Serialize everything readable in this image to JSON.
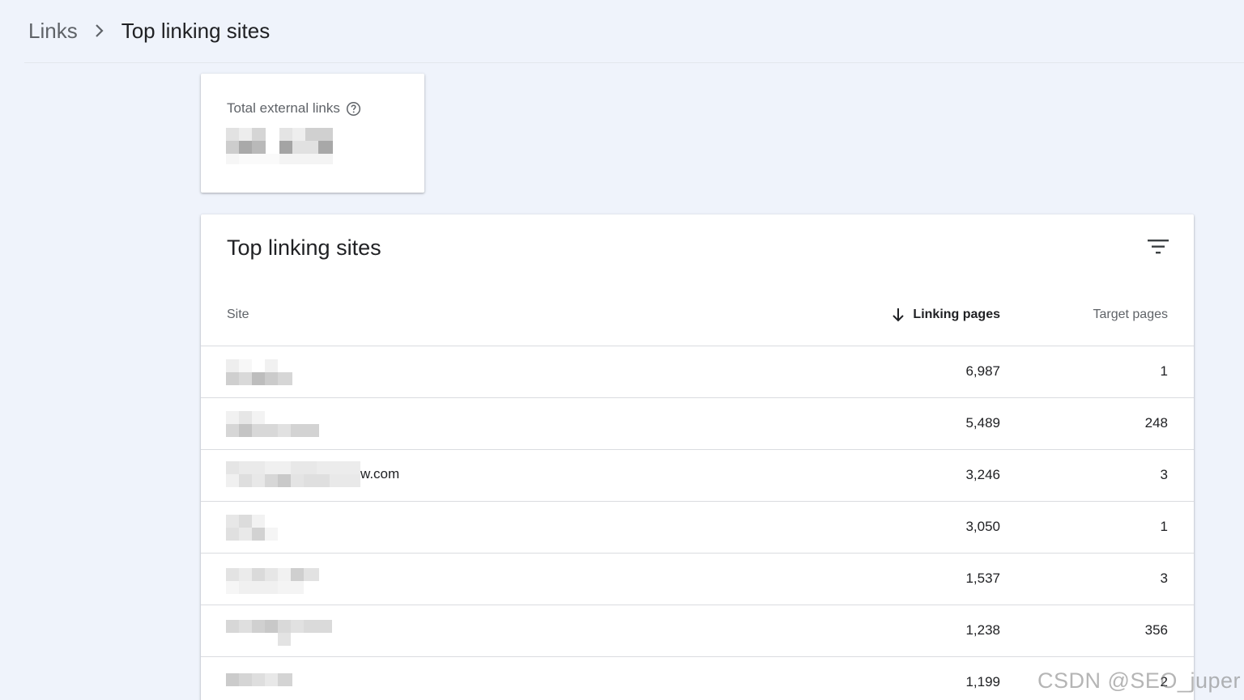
{
  "breadcrumb": {
    "parent": "Links",
    "current": "Top linking sites"
  },
  "summary": {
    "label": "Total external links"
  },
  "table": {
    "title": "Top linking sites",
    "columns": {
      "site": "Site",
      "linking_pages": "Linking pages",
      "target_pages": "Target pages"
    },
    "rows": [
      {
        "site_suffix": "",
        "linking_pages": "6,987",
        "target_pages": "1"
      },
      {
        "site_suffix": "",
        "linking_pages": "5,489",
        "target_pages": "248"
      },
      {
        "site_suffix": "w.com",
        "linking_pages": "3,246",
        "target_pages": "3"
      },
      {
        "site_suffix": "",
        "linking_pages": "3,050",
        "target_pages": "1"
      },
      {
        "site_suffix": "",
        "linking_pages": "1,537",
        "target_pages": "3"
      },
      {
        "site_suffix": "",
        "linking_pages": "1,238",
        "target_pages": "356"
      },
      {
        "site_suffix": "",
        "linking_pages": "1,199",
        "target_pages": "2"
      }
    ]
  },
  "watermark": "CSDN @SEO_juper",
  "colors": {
    "page_background": "#eff3fb",
    "card_background": "#ffffff",
    "text_primary": "#202124",
    "text_secondary": "#5f6368",
    "divider": "#dadce0"
  }
}
